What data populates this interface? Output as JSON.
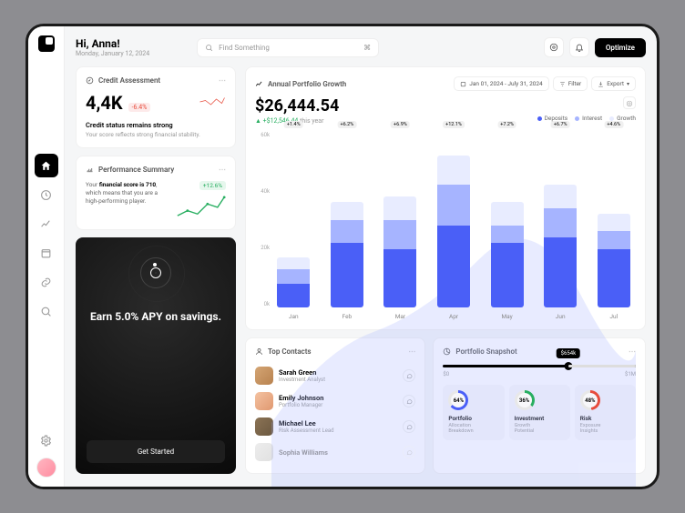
{
  "header": {
    "greeting": "Hi, Anna!",
    "date": "Monday, January 12, 2024",
    "search_placeholder": "Find Something",
    "search_shortcut": "⌘",
    "optimize_label": "Optimize"
  },
  "credit": {
    "title": "Credit Assessment",
    "value": "4,4K",
    "delta": "-6.4%",
    "status": "Credit status remains strong",
    "sub": "Your score reflects strong financial stability."
  },
  "performance": {
    "title": "Performance Summary",
    "text_prefix": "Your ",
    "text_bold": "financial score is 710",
    "text_suffix": ", which means that you are a high-performing player.",
    "badge": "+12.6%"
  },
  "promo": {
    "headline": "Earn 5.0% APY on savings.",
    "cta": "Get Started"
  },
  "chart": {
    "title": "Annual Portfolio Growth",
    "date_range": "Jan 01, 2024 - July 31, 2024",
    "filter_label": "Filter",
    "export_label": "Export",
    "value": "$26,444.54",
    "delta_value": "+$12,546.44",
    "delta_suffix": "this year",
    "legend": {
      "deposits": "Deposits",
      "interest": "Interest",
      "growth": "Growth"
    },
    "y_ticks": [
      "60k",
      "40k",
      "20k",
      "0k"
    ]
  },
  "chart_data": {
    "type": "bar",
    "categories": [
      "Jan",
      "Feb",
      "Mar",
      "Apr",
      "May",
      "Jun",
      "Jul"
    ],
    "series": [
      {
        "name": "Deposits",
        "values": [
          8,
          22,
          20,
          28,
          22,
          24,
          20
        ]
      },
      {
        "name": "Interest",
        "values": [
          5,
          8,
          10,
          14,
          6,
          10,
          6
        ]
      },
      {
        "name": "Growth",
        "values": [
          4,
          6,
          8,
          10,
          8,
          8,
          6
        ]
      }
    ],
    "pct_labels": [
      "+1.4%",
      "+6.2%",
      "+6.9%",
      "+12.1%",
      "+7.2%",
      "+6.7%",
      "+4.6%"
    ],
    "ylim": [
      0,
      60
    ],
    "ylabel": "",
    "xlabel": ""
  },
  "contacts": {
    "title": "Top Contacts",
    "items": [
      {
        "name": "Sarah Green",
        "role": "Investment Analyst"
      },
      {
        "name": "Emily Johnson",
        "role": "Portfolio Manager"
      },
      {
        "name": "Michael Lee",
        "role": "Risk Assessment Lead"
      },
      {
        "name": "Sophia Williams",
        "role": ""
      }
    ]
  },
  "snapshot": {
    "title": "Portfolio Snapshot",
    "slider_value": "$654k",
    "slider_min": "$0",
    "slider_max": "$1M",
    "cards": [
      {
        "pct": "64%",
        "title": "Portfolio",
        "sub1": "Allocation",
        "sub2": "Breakdown",
        "color": "#4a5ff7"
      },
      {
        "pct": "36%",
        "title": "Investment",
        "sub1": "Growth",
        "sub2": "Potential",
        "color": "#27ae60"
      },
      {
        "pct": "48%",
        "title": "Risk",
        "sub1": "Exposure",
        "sub2": "Insights",
        "color": "#e74c3c"
      }
    ]
  }
}
